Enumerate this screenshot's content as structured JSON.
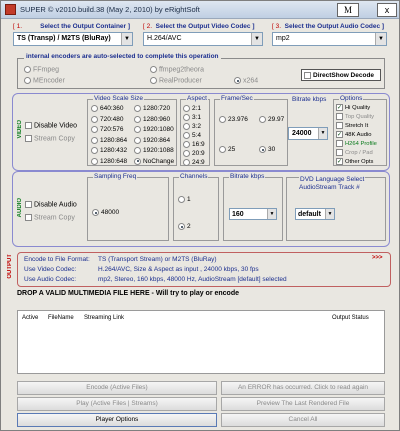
{
  "window": {
    "title": "SUPER © v2010.build.38 (May 2, 2010) by eRightSoft",
    "m_label": "M",
    "close_label": "x"
  },
  "headers": {
    "container": {
      "num": "[ 1.",
      "text": "Select the Output Container ]"
    },
    "video": {
      "num": "[ 2.",
      "text": "Select the Output Video Codec ]"
    },
    "audio": {
      "num": "[ 3.",
      "text": "Select the Output Audio Codec ]"
    }
  },
  "combos": {
    "container": "TS (Transp) / M2TS (BluRay)",
    "video_codec": "H.264/AVC",
    "audio_codec": "mp2"
  },
  "encoders": {
    "caption": "internal encoders are auto-selected to complete this operation",
    "items": [
      "FFmpeg",
      "ffmpeg2theora",
      "MEncoder",
      "RealProducer",
      "x264"
    ],
    "directshow": "DirectShow Decode"
  },
  "video": {
    "side_label": "VIDEO",
    "disable": "Disable Video",
    "stream_copy": "Stream Copy",
    "scale": {
      "caption": "Video Scale Size",
      "items": [
        "640:360",
        "1280:720",
        "720:480",
        "1280:960",
        "720:576",
        "1920:1080",
        "1280:864",
        "1920:864",
        "1280:432",
        "1920:1088",
        "1280:648",
        "NoChange"
      ]
    },
    "aspect": {
      "caption": "Aspect",
      "items": [
        "2:1",
        "3:1",
        "3:2",
        "5:4",
        "16:9",
        "20:9",
        "24:9"
      ]
    },
    "fps": {
      "caption": "Frame/Sec",
      "items": [
        "23.976",
        "29.97",
        "25",
        "30"
      ]
    },
    "bitrate": {
      "caption": "Bitrate  kbps",
      "value": "24000"
    },
    "options": {
      "caption": "Options",
      "items": [
        "Hi Quality",
        "Top Quality",
        "Stretch It",
        "48K Audio",
        "H264 Profile",
        "Crop / Pad",
        "Other Opts"
      ]
    }
  },
  "audio": {
    "side_label": "AUDIO",
    "disable": "Disable Audio",
    "stream_copy": "Stream Copy",
    "sampling": {
      "caption": "Sampling Freq",
      "value": "48000"
    },
    "channels": {
      "caption": "Channels",
      "items": [
        "1",
        "2"
      ]
    },
    "bitrate": {
      "caption": "Bitrate  kbps",
      "value": "160"
    },
    "dvd": {
      "caption_1": "DVD Language Select",
      "caption_2": "AudioStream  Track #",
      "value": "default"
    }
  },
  "output": {
    "side_label": "OUTPUT",
    "rows": [
      {
        "label": "Encode to File Format:",
        "value": "TS (Transport Stream) or M2TS (BluRay)"
      },
      {
        "label": "Use Video Codec:",
        "value": "H.264/AVC,  Size & Aspect as input ,  24000 kbps,  30 fps"
      },
      {
        "label": "Use Audio Codec:",
        "value": "mp2,  Stereo,  160 kbps,  48000 Hz,  AudioStream [default] selected"
      }
    ],
    "more": ">>>"
  },
  "drop_text": "DROP A VALID MULTIMEDIA FILE HERE - Will try to play or encode",
  "table": {
    "columns": [
      "Active",
      "FileName",
      "Streaming Link",
      "Output Status"
    ]
  },
  "buttons": {
    "encode": "Encode (Active Files)",
    "error": "An ERROR has occurred.  Click to read again",
    "play": "Play (Active Files | Streams)",
    "preview": "Preview The Last Rendered File",
    "player_options": "Player Options",
    "cancel": "Cancel All"
  },
  "colors": {
    "accent_blue": "#1c2f8f",
    "header_red": "#c00000",
    "side_green": "#0b7b1d",
    "output_red": "#c00000"
  }
}
